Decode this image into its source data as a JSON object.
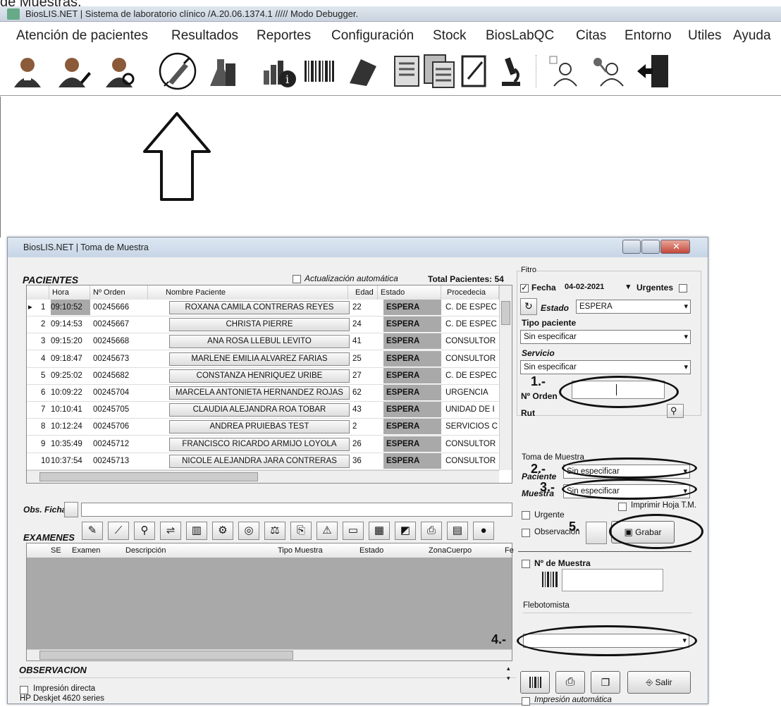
{
  "doc_note": "de Muestras.",
  "app": {
    "title": "BiosLIS.NET | Sistema de laboratorio clínico /A.20.06.1374.1  ///// Modo Debugger."
  },
  "menu": [
    "Atención de pacientes",
    "Resultados",
    "Reportes",
    "Configuración",
    "Stock",
    "BiosLabQC",
    "Citas",
    "Entorno",
    "Utiles",
    "Ayuda"
  ],
  "toolbar_icons": [
    "patient-icon",
    "patient-edit-icon",
    "patient-search-icon",
    "syringe-icon",
    "lab-flask-icon",
    "stats-info-icon",
    "barcode-icon",
    "sample-icon",
    "report-icon",
    "reports-icon",
    "notebook-icon",
    "microscope-icon",
    "user-permissions-icon",
    "user-keys-icon",
    "exit-door-icon"
  ],
  "window": {
    "title": "BiosLIS.NET | Toma de Muestra"
  },
  "pacientes": {
    "title": "PACIENTES",
    "auto_update_label": "Actualización automática",
    "total_label": "Total Pacientes: 54",
    "columns": [
      "Hora",
      "Nº Orden",
      "Nombre Paciente",
      "Edad",
      "Estado",
      "Procedecia"
    ],
    "rows": [
      {
        "n": "1",
        "hora": "09:10:52",
        "orden": "00245666",
        "nombre": "ROXANA CAMILA CONTRERAS REYES",
        "edad": "22",
        "estado": "ESPERA",
        "proc": "C. DE ESPEC"
      },
      {
        "n": "2",
        "hora": "09:14:53",
        "orden": "00245667",
        "nombre": "CHRISTA PIERRE",
        "edad": "24",
        "estado": "ESPERA",
        "proc": "C. DE ESPEC"
      },
      {
        "n": "3",
        "hora": "09:15:20",
        "orden": "00245668",
        "nombre": "ANA ROSA LLEBUL LEVITO",
        "edad": "41",
        "estado": "ESPERA",
        "proc": "CONSULTOR"
      },
      {
        "n": "4",
        "hora": "09:18:47",
        "orden": "00245673",
        "nombre": "MARLENE EMILIA ALVAREZ FARIAS",
        "edad": "25",
        "estado": "ESPERA",
        "proc": "CONSULTOR"
      },
      {
        "n": "5",
        "hora": "09:25:02",
        "orden": "00245682",
        "nombre": "CONSTANZA HENRIQUEZ URIBE",
        "edad": "27",
        "estado": "ESPERA",
        "proc": "C. DE ESPEC"
      },
      {
        "n": "6",
        "hora": "10:09:22",
        "orden": "00245704",
        "nombre": "MARCELA ANTONIETA HERNANDEZ ROJAS",
        "edad": "62",
        "estado": "ESPERA",
        "proc": "URGENCIA"
      },
      {
        "n": "7",
        "hora": "10:10:41",
        "orden": "00245705",
        "nombre": "CLAUDIA ALEJANDRA ROA TOBAR",
        "edad": "43",
        "estado": "ESPERA",
        "proc": "UNIDAD DE I"
      },
      {
        "n": "8",
        "hora": "10:12:24",
        "orden": "00245706",
        "nombre": "ANDREA PRUIEBAS TEST",
        "edad": "2",
        "estado": "ESPERA",
        "proc": "SERVICIOS C"
      },
      {
        "n": "9",
        "hora": "10:35:49",
        "orden": "00245712",
        "nombre": "FRANCISCO RICARDO ARMIJO LOYOLA",
        "edad": "26",
        "estado": "ESPERA",
        "proc": "CONSULTOR"
      },
      {
        "n": "10",
        "hora": "10:37:54",
        "orden": "00245713",
        "nombre": "NICOLE ALEJANDRA JARA CONTRERAS",
        "edad": "36",
        "estado": "ESPERA",
        "proc": "CONSULTOR"
      }
    ]
  },
  "obs_ficha_label": "Obs. Ficha",
  "examenes": {
    "title": "EXAMENES",
    "columns": [
      "SE",
      "Examen",
      "Descripción",
      "Tipo Muestra",
      "Estado",
      "ZonaCuerpo",
      "Fe"
    ]
  },
  "observacion_label": "OBSERVACION",
  "impresion_directa_label": "Impresión directa",
  "printer": "HP Deskjet 4620 series",
  "filtro": {
    "title": "Fitro",
    "fecha_label": "Fecha",
    "fecha_value": "04-02-2021",
    "urgentes_label": "Urgentes",
    "estado_label": "Estado",
    "estado_value": "ESPERA",
    "tipo_paciente_label": "Tipo paciente",
    "tipo_paciente_value": "Sin especificar",
    "servicio_label": "Servicio",
    "servicio_value": "Sin especificar",
    "orden_label": "Nº Orden",
    "rut_label": "Rut"
  },
  "toma": {
    "title": "Toma de Muestra",
    "paciente_label": "Paciente",
    "paciente_value": "Sin especificar",
    "muestra_label": "Muestra",
    "muestra_value": "Sin especificar",
    "imprimir_label": "Imprimir Hoja T.M.",
    "urgente_label": "Urgente",
    "observacion_label": "Observación",
    "grabar_label": "Grabar",
    "nmuestra_label": "Nº de Muestra",
    "flebotomista_label": "Flebotomista",
    "salir_label": "Salir",
    "impresion_auto_label": "Impresión automática"
  },
  "annotations": [
    "1.-",
    "2.-",
    "3.-",
    "4.-",
    "5."
  ]
}
